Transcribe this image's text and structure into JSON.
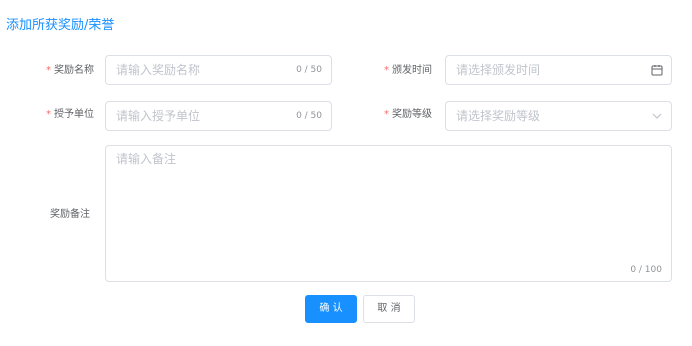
{
  "header": {
    "title": "添加所获奖励/荣誉"
  },
  "form": {
    "award_name": {
      "label": "奖励名称",
      "required_mark": "*",
      "placeholder": "请输入奖励名称",
      "count": "0 / 50"
    },
    "issue_time": {
      "label": "颁发时间",
      "required_mark": "*",
      "placeholder": "请选择颁发时间",
      "icon": "calendar-icon"
    },
    "grantor": {
      "label": "授予单位",
      "required_mark": "*",
      "placeholder": "请输入授予单位",
      "count": "0 / 50"
    },
    "award_level": {
      "label": "奖励等级",
      "required_mark": "*",
      "placeholder": "请选择奖励等级",
      "icon": "chevron-down-icon"
    },
    "remarks": {
      "label": "奖励备注",
      "placeholder": "请输入备注",
      "count": "0 / 100"
    }
  },
  "actions": {
    "confirm_label": "确 认",
    "cancel_label": "取 消"
  },
  "colors": {
    "primary": "#1890ff",
    "required": "#f56c6c",
    "border": "#dcdfe6",
    "placeholder": "#c0c4cc"
  }
}
